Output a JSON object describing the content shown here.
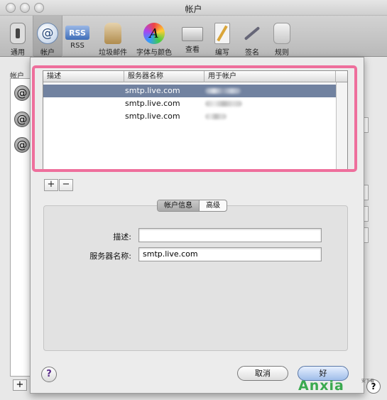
{
  "window": {
    "title": "帐户"
  },
  "toolbar": {
    "items": [
      {
        "label": "通用",
        "icon": "switch-icon"
      },
      {
        "label": "帐户",
        "icon": "at-icon"
      },
      {
        "label": "RSS",
        "icon": "rss-icon"
      },
      {
        "label": "垃圾邮件",
        "icon": "junk-bag-icon"
      },
      {
        "label": "字体与颜色",
        "icon": "font-icon"
      },
      {
        "label": "查看",
        "icon": "envelope-icon"
      },
      {
        "label": "编写",
        "icon": "pencil-icon"
      },
      {
        "label": "签名",
        "icon": "signature-icon"
      },
      {
        "label": "规则",
        "icon": "rules-icon"
      }
    ],
    "rss_badge": "RSS",
    "font_glyph": "A",
    "at_glyph": "@"
  },
  "background": {
    "accounts_header": "帐户",
    "plus": "+",
    "help": "?"
  },
  "smtp_table": {
    "columns": [
      "描述",
      "服务器名称",
      "用于帐户"
    ],
    "rows": [
      {
        "server": "smtp.live.com",
        "selected": true
      },
      {
        "server": "smtp.live.com",
        "selected": false
      },
      {
        "server": "smtp.live.com",
        "selected": false
      }
    ]
  },
  "controls": {
    "add": "+",
    "remove": "−"
  },
  "tabs": {
    "account_info": "帐户信息",
    "advanced": "高级"
  },
  "form": {
    "description_label": "描述:",
    "description_value": "",
    "server_label": "服务器名称:",
    "server_value": "smtp.live.com"
  },
  "buttons": {
    "help": "?",
    "cancel": "取消",
    "ok": "好"
  },
  "watermark": {
    "text": "Anxia",
    "sub": "安下载 "
  },
  "colors": {
    "selection": "#7182a0",
    "highlight": "#ee6f9c",
    "watermark": "#3aa94f"
  }
}
